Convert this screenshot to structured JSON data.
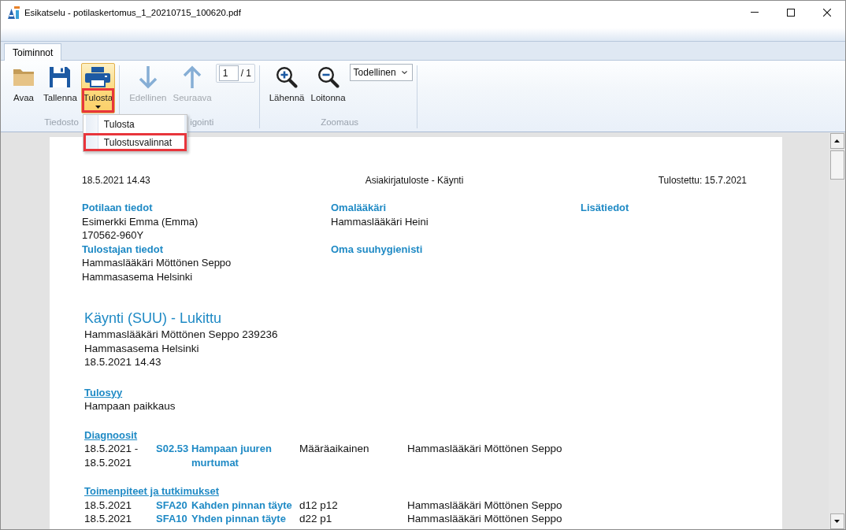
{
  "window": {
    "title": "Esikatselu - potilaskertomus_1_20210715_100620.pdf"
  },
  "ribbon": {
    "tabs": [
      {
        "label": "Toiminnot",
        "selected": true
      }
    ],
    "groups": [
      {
        "label": "Tiedosto",
        "buttons": [
          {
            "kind": "open",
            "label": "Avaa",
            "disabled": false,
            "expanded": false,
            "highlighted": false
          },
          {
            "kind": "save",
            "label": "Tallenna",
            "disabled": false,
            "expanded": false,
            "highlighted": false
          },
          {
            "kind": "print",
            "label": "Tulosta",
            "disabled": false,
            "expanded": true,
            "highlighted": true,
            "menu": [
              {
                "label": "Tulosta",
                "highlighted": false
              },
              {
                "label": "Tulostusvalinnat",
                "highlighted": true
              }
            ]
          }
        ]
      },
      {
        "label": "igointi",
        "buttons": [
          {
            "kind": "previous",
            "label": "Edellinen",
            "disabled": true,
            "expanded": false,
            "highlighted": false
          },
          {
            "kind": "next",
            "label": "Seuraava",
            "disabled": true,
            "expanded": false,
            "highlighted": false
          }
        ],
        "page_field": {
          "value": "1",
          "total": "/ 1"
        }
      },
      {
        "label": "Zoomaus",
        "buttons": [
          {
            "kind": "zoom_in",
            "label": "Lähennä",
            "disabled": false,
            "expanded": false,
            "highlighted": false
          },
          {
            "kind": "zoom_out",
            "label": "Loitonna",
            "disabled": false,
            "expanded": false,
            "highlighted": false
          }
        ],
        "zoom_select": {
          "value": "Todellinen"
        }
      }
    ]
  },
  "document": {
    "header": {
      "left": "18.5.2021 14.43",
      "center": "Asiakirjatuloste - Käynti",
      "right": "Tulostettu: 15.7.2021"
    },
    "info_columns": [
      {
        "sections": [
          {
            "heading": "Potilaan tiedot",
            "lines": [
              "Esimerkki Emma (Emma)",
              "170562-960Y"
            ]
          },
          {
            "heading": "Tulostajan tiedot",
            "lines": [
              "Hammaslääkäri Möttönen Seppo",
              "Hammasasema Helsinki"
            ]
          }
        ]
      },
      {
        "sections": [
          {
            "heading": "Omalääkäri",
            "lines": [
              "Hammaslääkäri Heini"
            ]
          },
          {
            "heading": "Oma suuhygienisti"
          }
        ]
      },
      {
        "sections": [
          {
            "heading": "Lisätiedot"
          }
        ]
      }
    ],
    "visit": {
      "title": "Käynti (SUU) - Lukittu",
      "lines": [
        "Hammaslääkäri Möttönen Seppo 239236",
        "Hammasasema Helsinki",
        "18.5.2021 14.43"
      ]
    },
    "sections": [
      {
        "kind": "text",
        "heading": "Tulosyy",
        "lines": [
          "Hampaan paikkaus"
        ]
      },
      {
        "kind": "table",
        "heading": "Diagnoosit",
        "rows": [
          {
            "column_1": "18.5.2021 - 18.5.2021",
            "column_2": "S02.53",
            "column_3": "Hampaan juuren murtumat",
            "column_4": "Määräaikainen",
            "column_5": "Hammaslääkäri Möttönen Seppo"
          }
        ]
      },
      {
        "kind": "table",
        "heading": "Toimenpiteet ja tutkimukset",
        "rows": [
          {
            "column_1": "18.5.2021",
            "column_2": "SFA20",
            "column_3": "Kahden pinnan täyte",
            "column_4": "d12 p12",
            "column_5": "Hammaslääkäri Möttönen Seppo"
          },
          {
            "column_1": "18.5.2021",
            "column_2": "SFA10",
            "column_3": "Yhden pinnan täyte",
            "column_4": "d22 p1",
            "column_5": "Hammaslääkäri Möttönen Seppo"
          }
        ]
      }
    ]
  }
}
